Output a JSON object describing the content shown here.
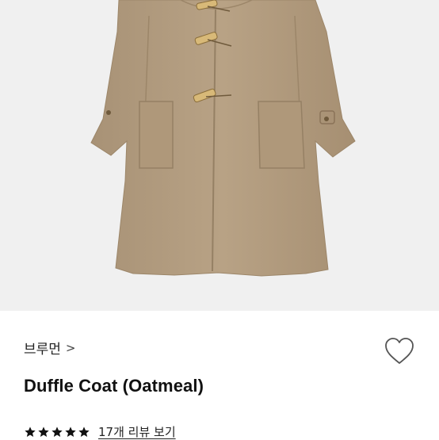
{
  "product": {
    "brand": "브루먼",
    "title": "Duffle Coat (Oatmeal)",
    "image_alt": "Duffle coat in oatmeal color",
    "rating": 5,
    "rating_max": 5,
    "review_link": "17개 리뷰 보기"
  },
  "icons": {
    "brand_chevron": ">",
    "like": "heart-outline-icon",
    "star": "star-filled-icon"
  },
  "colors": {
    "coat": "#b59e80",
    "image_bg": "#f0f0f0",
    "star": "#111111"
  }
}
